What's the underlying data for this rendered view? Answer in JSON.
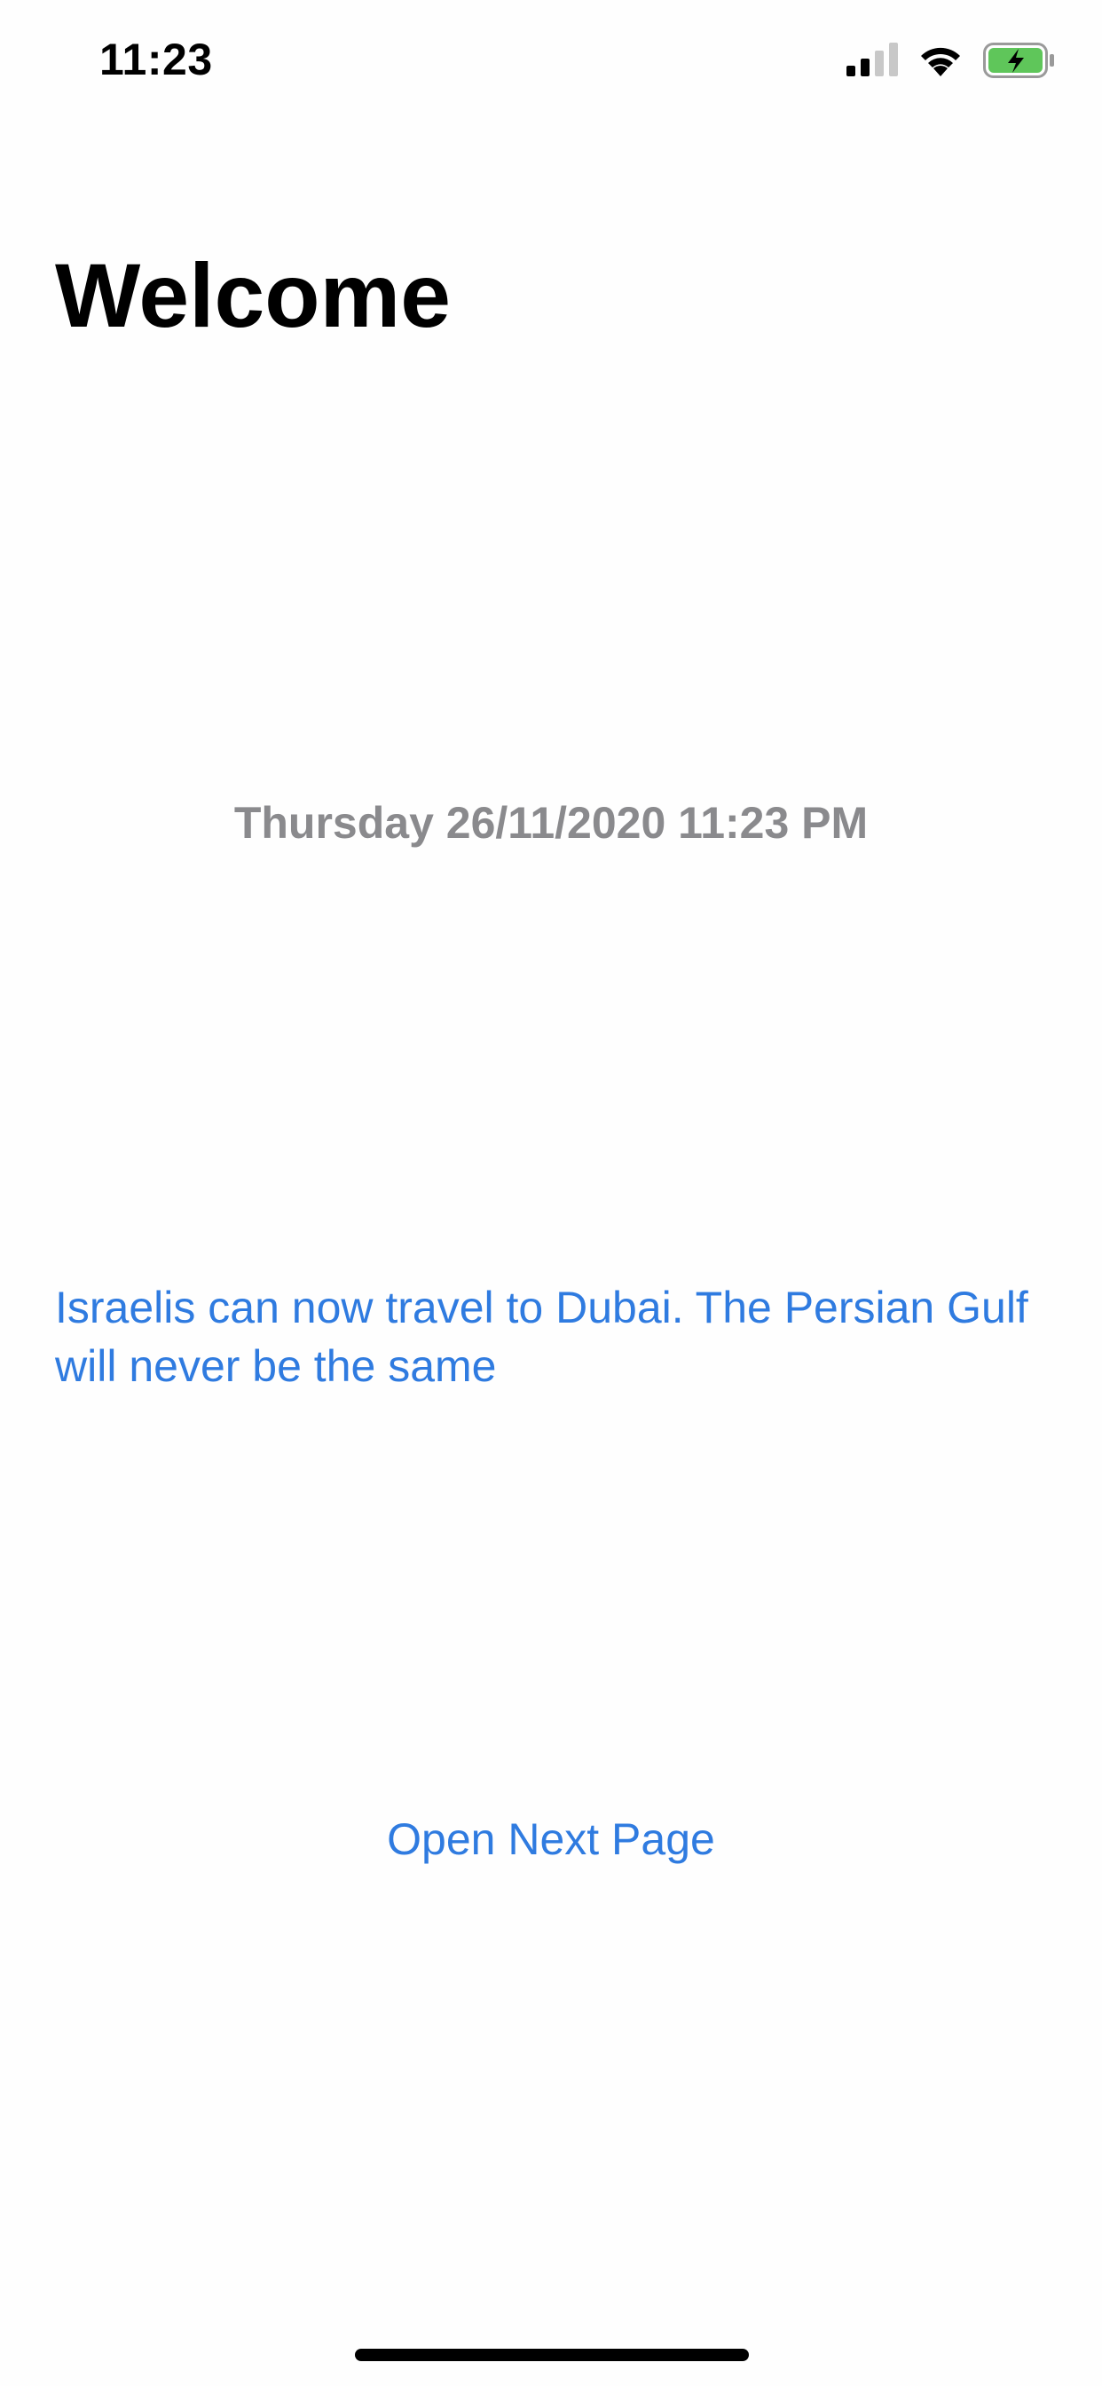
{
  "status_bar": {
    "time": "11:23",
    "icons": [
      "signal-icon",
      "wifi-icon",
      "battery-charging-icon"
    ],
    "battery_color": "#5fc65a"
  },
  "main": {
    "title": "Welcome",
    "date_text": "Thursday 26/11/2020 11:23 PM",
    "headline": "Israelis can now travel to Dubai. The Persian Gulf will never be the same",
    "next_page_label": "Open Next Page"
  },
  "colors": {
    "link": "#2f7be0",
    "date_text": "#8a8a8d"
  }
}
